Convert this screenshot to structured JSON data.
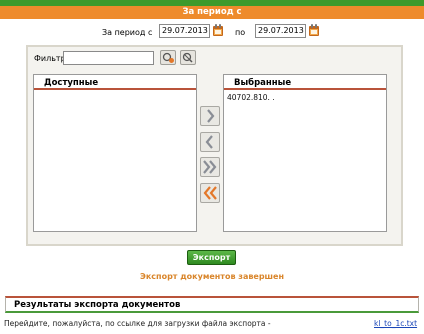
{
  "header": {
    "title": "За период с"
  },
  "period": {
    "from_label": "За период с",
    "from_date": "29.07.2013",
    "to_label": "по",
    "to_date": "29.07.2013"
  },
  "filter": {
    "label": "Фильтр",
    "value": ""
  },
  "available": {
    "title": "Доступные",
    "items": []
  },
  "selected": {
    "title": "Выбранные",
    "items": [
      "40702.810.  ."
    ]
  },
  "transfer_buttons": [
    "move-right",
    "move-left",
    "move-all-right",
    "move-all-left"
  ],
  "export": {
    "button_label": "Экспорт",
    "status": "Экспорт документов завершен"
  },
  "results": {
    "title": "Результаты экспорта документов",
    "instruction": "Перейдите, пожалуйста, по ссылке для загрузки файла экспорта -",
    "link_text": "kl_to_1c.txt"
  },
  "colors": {
    "top_bar": "#3e9a2c",
    "header": "#ee8b2c",
    "export_button": "#3f9a2f",
    "status_text": "#d9852a",
    "accent_line": "#b9533a",
    "link": "#1b47b8"
  }
}
